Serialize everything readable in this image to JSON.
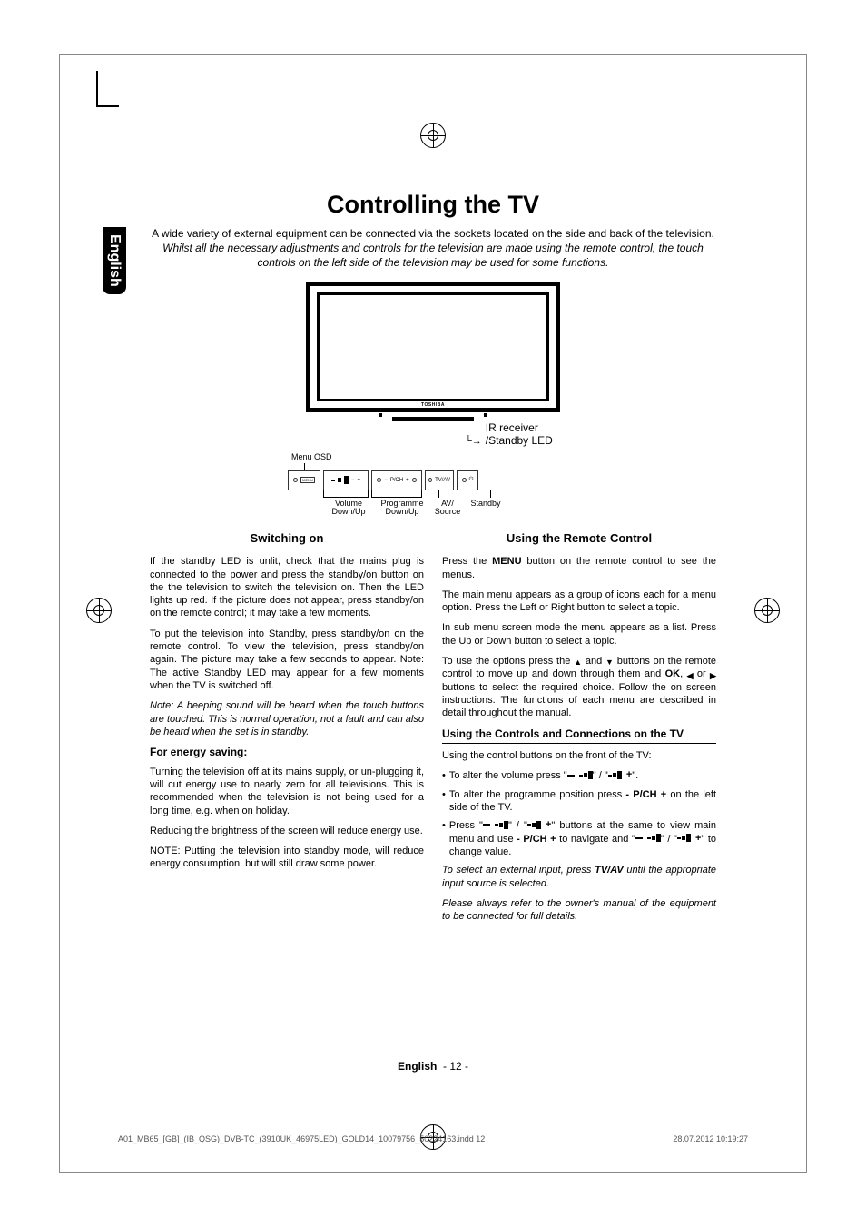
{
  "language_tab": "English",
  "title": "Controlling the TV",
  "intro_plain": "A wide variety of external equipment can be connected via the sockets located on the side and back of the television. ",
  "intro_italic": "Whilst all the necessary adjustments and controls for the television are made using the remote control, the touch controls on the left side of the television may be used for some functions.",
  "diagram": {
    "brand": "TOSHIBA",
    "ir_label": "IR receiver /Standby LED",
    "menu_osd": "Menu OSD",
    "panel_buttons": {
      "menu": "MENU",
      "pch": "P/CH",
      "tvav": "TV/AV"
    },
    "panel_labels": {
      "volume": "Volume Down/Up",
      "programme": "Programme Down/Up",
      "source": "AV/ Source",
      "standby": "Standby"
    }
  },
  "left": {
    "heading1": "Switching on",
    "p1": "If the standby LED is unlit, check that the mains plug is connected to the power and press the standby/on button on the the television to switch the television on. Then the LED lights up red. If the picture does not appear, press standby/on on the remote control; it may take a few moments.",
    "p2": "To put the television into Standby, press standby/on on the remote control. To view the television, press standby/on again. The picture may take a few seconds to appear. Note: The active Standby LED may appear for a few moments when the TV is switched off.",
    "note": "Note: A beeping sound will be heard when the touch buttons are touched. This is normal operation, not a fault and can also be heard when the set is in standby.",
    "heading2": "For energy saving:",
    "p3": "Turning the television off at its mains supply, or un-plugging it, will cut energy use to nearly zero for all televisions. This is recommended when the television is not being used for a long time, e.g. when on holiday.",
    "p4": "Reducing the brightness of the screen will reduce energy use.",
    "p5": "NOTE: Putting the television into standby mode, will reduce energy consumption, but will still draw some power."
  },
  "right": {
    "heading1": "Using the Remote Control",
    "p1a": "Press the ",
    "p1b": "MENU",
    "p1c": " button on the remote control to see the menus.",
    "p2": "The main menu appears as a group of icons each for a menu option. Press the Left or Right button to select a topic.",
    "p3": "In sub menu screen mode the menu appears as a list. Press the Up or Down button to select a topic.",
    "p4a": "To use the options press the ",
    "p4b": " and ",
    "p4c": " buttons on the remote control to move up and down through them and ",
    "p4d": "OK",
    "p4e": ", ",
    "p4f": " or ",
    "p4g": " buttons to select the required choice. Follow the on screen instructions. The functions of each menu are described in detail throughout the manual.",
    "heading2": "Using the Controls and Connections on the TV",
    "p5": "Using the control buttons on the front of the TV:",
    "b1a": "To alter the volume press \"",
    "b1b": "\" / \"",
    "b1c": "\".",
    "b2a": "To alter the programme position press ",
    "b2b": "- P/CH +",
    "b2c": " on the left side of the TV.",
    "b3a": "Press \"",
    "b3b": "\" / \"",
    "b3c": "\" buttons at the same to view main menu and use ",
    "b3d": "- P/CH +",
    "b3e": " to navigate and \"",
    "b3f": "\" / \"",
    "b3g": "\" to change value.",
    "p6a": "To select an external input, press ",
    "p6b": "TV/AV",
    "p6c": " until the appropriate input source is selected.",
    "p7": "Please always refer to the owner's manual of the equipment to be connected for full details."
  },
  "footer": {
    "lang": "English",
    "page": "- 12 -",
    "indd": "A01_MB65_[GB]_(IB_QSG)_DVB-TC_(3910UK_46975LED)_GOLD14_10079756_50224163.indd   12",
    "date": "28.07.2012   10:19:27"
  }
}
